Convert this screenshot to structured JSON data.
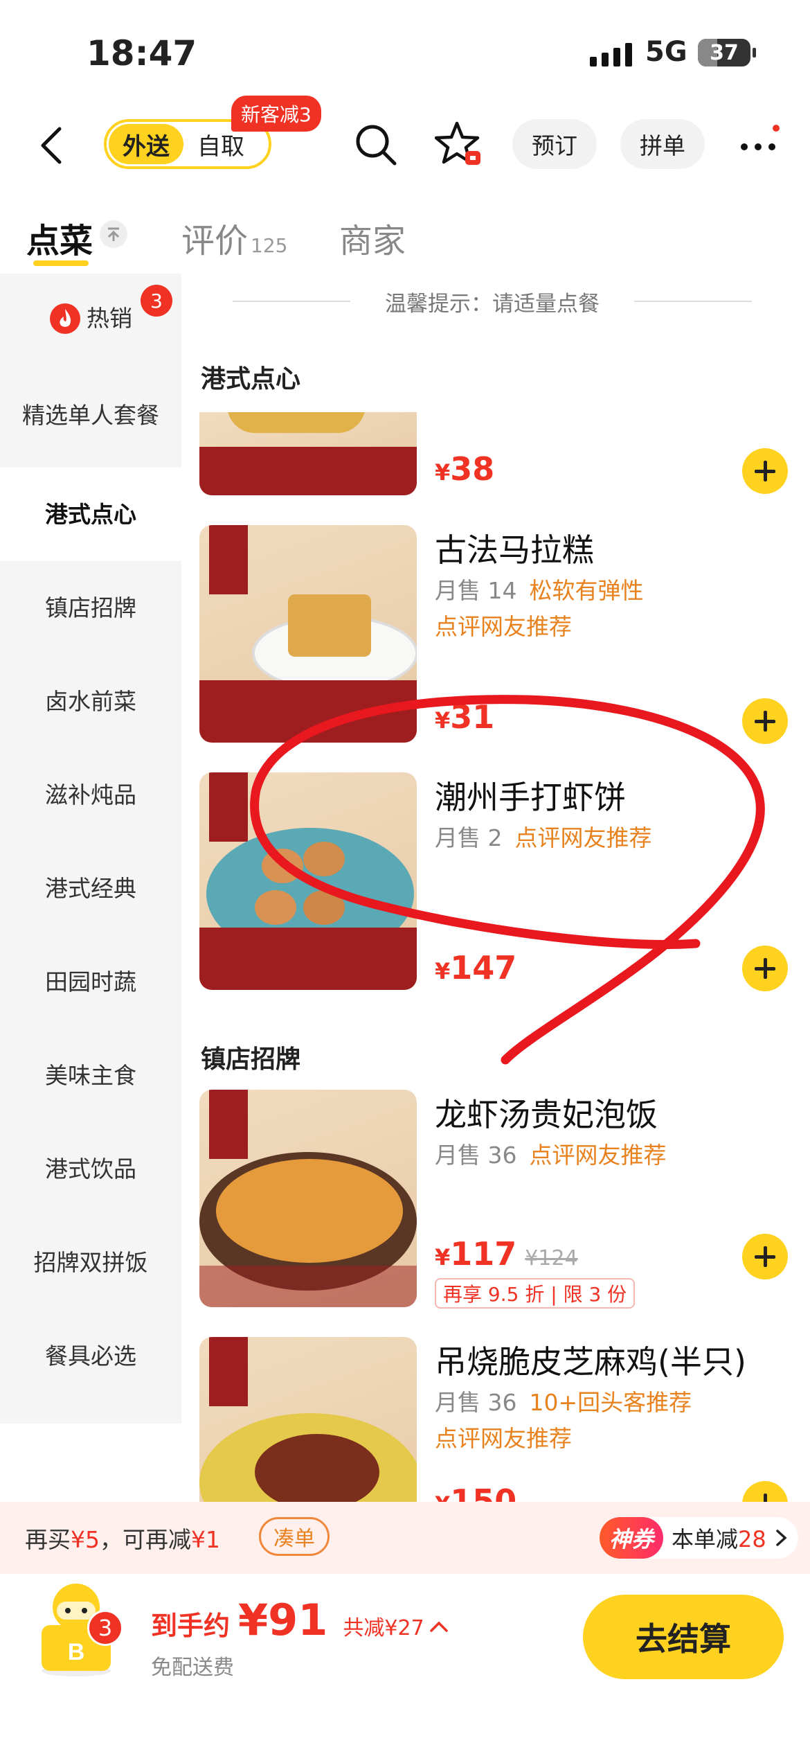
{
  "status_bar": {
    "time": "18:47",
    "network": "5G",
    "battery": "37",
    "battery_level": 0.37
  },
  "nav": {
    "mode_delivery": "外送",
    "mode_pickup": "自取",
    "new_customer_badge": "新客减3",
    "reserve_label": "预订",
    "group_order_label": "拼单"
  },
  "tabs": [
    {
      "label": "点菜",
      "count": ""
    },
    {
      "label": "评价",
      "count": "125"
    },
    {
      "label": "商家",
      "count": ""
    }
  ],
  "sidebar": {
    "items": [
      {
        "label": "热销",
        "badge": "3"
      },
      {
        "label": "精选单人套餐"
      },
      {
        "label": "港式点心"
      },
      {
        "label": "镇店招牌"
      },
      {
        "label": "卤水前菜"
      },
      {
        "label": "滋补炖品"
      },
      {
        "label": "港式经典"
      },
      {
        "label": "田园时蔬"
      },
      {
        "label": "美味主食"
      },
      {
        "label": "港式饮品"
      },
      {
        "label": "招牌双拼饭"
      },
      {
        "label": "餐具必选"
      }
    ]
  },
  "tip": "温馨提示：请适量点餐",
  "categories": [
    {
      "title": "港式点心"
    },
    {
      "title": "镇店招牌"
    }
  ],
  "dishes": [
    {
      "name": "",
      "price": "38",
      "currency": "¥"
    },
    {
      "name": "古法马拉糕",
      "sales": "月售 14",
      "tag": "松软有弹性",
      "extra": "点评网友推荐",
      "price": "31",
      "currency": "¥"
    },
    {
      "name": "潮州手打虾饼",
      "sales": "月售 2",
      "tag": "点评网友推荐",
      "price": "147",
      "currency": "¥"
    },
    {
      "name": "龙虾汤贵妃泡饭",
      "sales": "月售 36",
      "tag": "点评网友推荐",
      "price": "117",
      "orig_price": "¥124",
      "promo": "再享 9.5 折 | 限 3 份",
      "currency": "¥"
    },
    {
      "name": "吊烧脆皮芝麻鸡(半只)",
      "sales": "月售 36",
      "tag": "10+回头客推荐",
      "extra": "点评网友推荐",
      "price": "150",
      "currency": "¥"
    }
  ],
  "promo_bar": {
    "text_prefix": "再买",
    "amount_more": "¥5",
    "text_mid": "，可再减",
    "amount_off": "¥1",
    "add_button": "凑单",
    "coupon_tag": "神券",
    "coupon_text": "本单减",
    "coupon_amount": "28"
  },
  "checkout": {
    "cart_count": "3",
    "label": "到手约",
    "total": "¥91",
    "discount": "共减¥27",
    "delivery": "免配送费",
    "button": "去结算"
  },
  "colors": {
    "accent_yellow": "#ffd21f",
    "price_red": "#f03225",
    "tag_orange": "#e8821e"
  }
}
